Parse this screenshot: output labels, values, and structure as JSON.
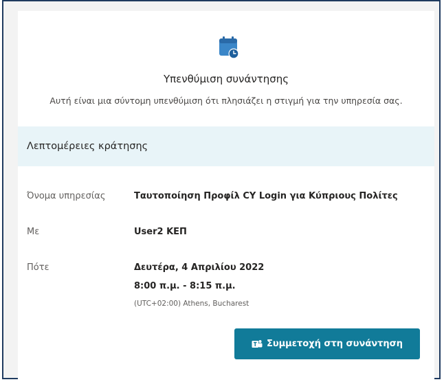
{
  "header": {
    "icon": "calendar-clock-icon",
    "title": "Υπενθύμιση συνάντησης",
    "subtitle": "Αυτή είναι μια σύντομη υπενθύμιση ότι πλησιάζει η στιγμή για την υπηρεσία σας."
  },
  "details": {
    "header": "Λεπτομέρειες κράτησης",
    "service_label": "Όνομα υπηρεσίας",
    "service_value": "Ταυτοποίηση Προφίλ CY Login για Κύπριους Πολίτες",
    "with_label": "Με",
    "with_value": "User2 ΚΕΠ",
    "when_label": "Πότε",
    "when_date": "Δευτέρα, 4 Απριλίου 2022",
    "when_time": "8:00 π.μ. - 8:15 π.μ.",
    "timezone": "(UTC+02:00) Athens, Bucharest"
  },
  "actions": {
    "join_label": "Συμμετοχή στη συνάντηση",
    "join_icon": "teams-icon"
  },
  "colors": {
    "accent": "#117b99",
    "header_bg": "#e8f4f8",
    "icon_blue": "#3a86c8"
  }
}
